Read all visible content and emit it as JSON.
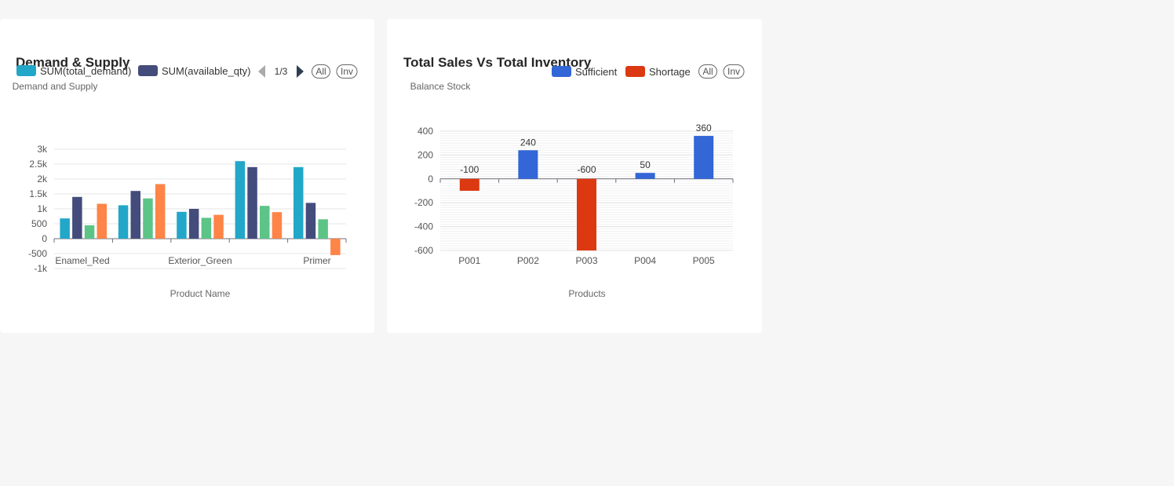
{
  "chart_data": [
    {
      "type": "bar",
      "title": "Demand & Supply",
      "ylabel": "Demand and Supply",
      "xlabel": "Product Name",
      "categories": [
        "Enamel_Red",
        "Exterior_Green",
        "Primer"
      ],
      "x_ticklabels_shown": [
        "Enamel_Red",
        "Exterior_Green",
        "Primer"
      ],
      "group_count": 5,
      "series": [
        {
          "name": "SUM(total_demand)",
          "color": "#22a7c9",
          "values": [
            680,
            1120,
            900,
            2600,
            2400
          ]
        },
        {
          "name": "SUM(available_qty)",
          "color": "#444c7c",
          "values": [
            1400,
            1600,
            1000,
            2400,
            1200
          ]
        },
        {
          "name": "",
          "color": "#5dc487",
          "values": [
            450,
            1350,
            700,
            1100,
            650
          ]
        },
        {
          "name": "",
          "color": "#fe8447",
          "values": [
            1170,
            1830,
            800,
            890,
            -550
          ]
        }
      ],
      "ylim": [
        -1000,
        3000
      ],
      "yticks": [
        "3k",
        "2.5k",
        "2k",
        "1.5k",
        "1k",
        "500",
        "0",
        "-500",
        "-1k"
      ],
      "ytick_values": [
        3000,
        2500,
        2000,
        1500,
        1000,
        500,
        0,
        -500,
        -1000
      ],
      "legend": {
        "placement": "top-left",
        "page_indicator": "1/3",
        "all_label": "All",
        "inv_label": "Inv"
      },
      "grid": true
    },
    {
      "type": "bar",
      "title": "Total Sales Vs Total Inventory",
      "ylabel": "Balance Stock",
      "xlabel": "Products",
      "categories": [
        "P001",
        "P002",
        "P003",
        "P004",
        "P005"
      ],
      "values": [
        -100,
        240,
        -600,
        50,
        360
      ],
      "data_labels": [
        "-100",
        "240",
        "-600",
        "50",
        "360"
      ],
      "series": [
        {
          "name": "Sufficient",
          "color": "#3366d6"
        },
        {
          "name": "Shortage",
          "color": "#dc3912"
        }
      ],
      "ylim": [
        -600,
        400
      ],
      "yticks": [
        "400",
        "200",
        "0",
        "-200",
        "-400",
        "-600"
      ],
      "ytick_values": [
        400,
        200,
        0,
        -200,
        -400,
        -600
      ],
      "legend": {
        "placement": "top-right",
        "all_label": "All",
        "inv_label": "Inv"
      },
      "grid": true
    }
  ]
}
